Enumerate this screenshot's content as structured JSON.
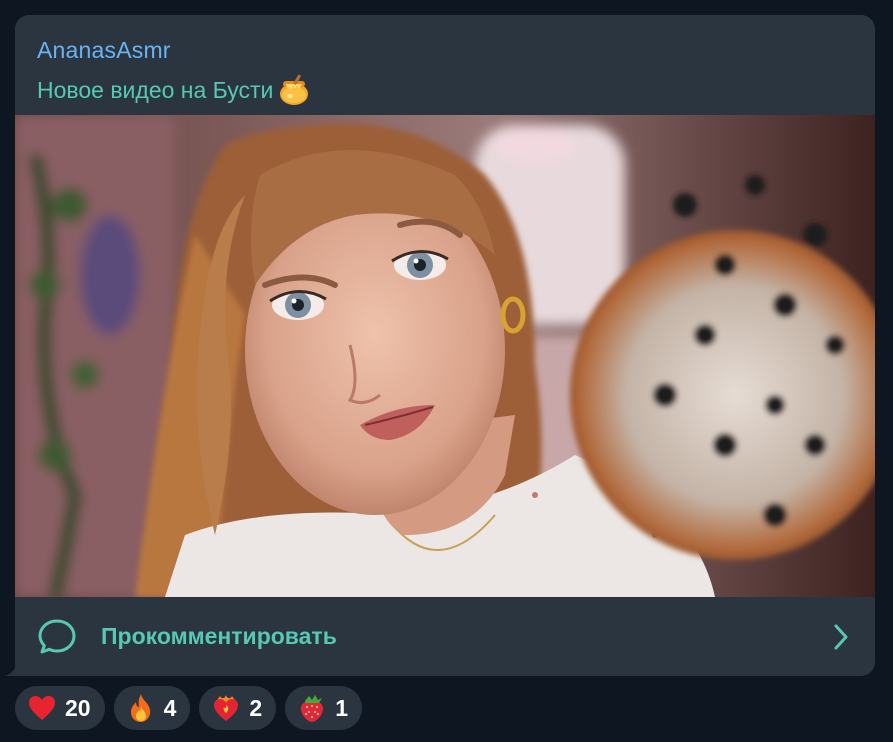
{
  "post": {
    "author": "AnanasAsmr",
    "caption": "Новое видео на Бусти",
    "caption_emoji": "honey-pot",
    "photo_description_icon": "photo"
  },
  "comment_bar": {
    "label": "Прокомментировать",
    "icon": "comment-bubble-icon",
    "arrow": "chevron-right-icon"
  },
  "reactions": [
    {
      "emoji": "red-heart",
      "count": "20"
    },
    {
      "emoji": "fire",
      "count": "4"
    },
    {
      "emoji": "heart-on-fire",
      "count": "2"
    },
    {
      "emoji": "strawberry",
      "count": "1"
    }
  ],
  "colors": {
    "background": "#0e1621",
    "bubble": "#2b3540",
    "author": "#6ab3f3",
    "accent": "#57c8b4",
    "count_text": "#ffffff"
  }
}
